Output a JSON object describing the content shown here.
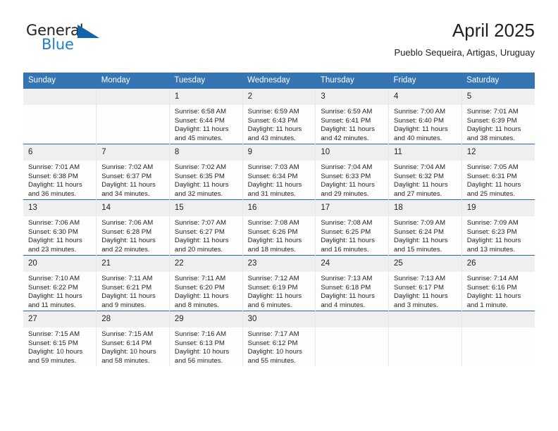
{
  "brand": {
    "word_top": "General",
    "word_bottom": "Blue",
    "triangle_icon": "triangle-logo-icon",
    "accent_dark": "#1464aa",
    "accent_light": "#1f7ec4"
  },
  "header": {
    "month_title": "April 2025",
    "location": "Pueblo Sequeira, Artigas, Uruguay",
    "header_bg": "#3575b4",
    "row_divider": "#1f6cb0",
    "daynum_bg": "#efefef"
  },
  "weekday_headers": [
    "Sunday",
    "Monday",
    "Tuesday",
    "Wednesday",
    "Thursday",
    "Friday",
    "Saturday"
  ],
  "labels": {
    "sunrise_prefix": "Sunrise:",
    "sunset_prefix": "Sunset:",
    "daylight_prefix": "Daylight:"
  },
  "weeks": [
    [
      {
        "date": "",
        "sunrise": "",
        "sunset": "",
        "daylight_line1": "",
        "daylight_line2": ""
      },
      {
        "date": "",
        "sunrise": "",
        "sunset": "",
        "daylight_line1": "",
        "daylight_line2": ""
      },
      {
        "date": "1",
        "sunrise": "Sunrise: 6:58 AM",
        "sunset": "Sunset: 6:44 PM",
        "daylight_line1": "Daylight: 11 hours",
        "daylight_line2": "and 45 minutes."
      },
      {
        "date": "2",
        "sunrise": "Sunrise: 6:59 AM",
        "sunset": "Sunset: 6:43 PM",
        "daylight_line1": "Daylight: 11 hours",
        "daylight_line2": "and 43 minutes."
      },
      {
        "date": "3",
        "sunrise": "Sunrise: 6:59 AM",
        "sunset": "Sunset: 6:41 PM",
        "daylight_line1": "Daylight: 11 hours",
        "daylight_line2": "and 42 minutes."
      },
      {
        "date": "4",
        "sunrise": "Sunrise: 7:00 AM",
        "sunset": "Sunset: 6:40 PM",
        "daylight_line1": "Daylight: 11 hours",
        "daylight_line2": "and 40 minutes."
      },
      {
        "date": "5",
        "sunrise": "Sunrise: 7:01 AM",
        "sunset": "Sunset: 6:39 PM",
        "daylight_line1": "Daylight: 11 hours",
        "daylight_line2": "and 38 minutes."
      }
    ],
    [
      {
        "date": "6",
        "sunrise": "Sunrise: 7:01 AM",
        "sunset": "Sunset: 6:38 PM",
        "daylight_line1": "Daylight: 11 hours",
        "daylight_line2": "and 36 minutes."
      },
      {
        "date": "7",
        "sunrise": "Sunrise: 7:02 AM",
        "sunset": "Sunset: 6:37 PM",
        "daylight_line1": "Daylight: 11 hours",
        "daylight_line2": "and 34 minutes."
      },
      {
        "date": "8",
        "sunrise": "Sunrise: 7:02 AM",
        "sunset": "Sunset: 6:35 PM",
        "daylight_line1": "Daylight: 11 hours",
        "daylight_line2": "and 32 minutes."
      },
      {
        "date": "9",
        "sunrise": "Sunrise: 7:03 AM",
        "sunset": "Sunset: 6:34 PM",
        "daylight_line1": "Daylight: 11 hours",
        "daylight_line2": "and 31 minutes."
      },
      {
        "date": "10",
        "sunrise": "Sunrise: 7:04 AM",
        "sunset": "Sunset: 6:33 PM",
        "daylight_line1": "Daylight: 11 hours",
        "daylight_line2": "and 29 minutes."
      },
      {
        "date": "11",
        "sunrise": "Sunrise: 7:04 AM",
        "sunset": "Sunset: 6:32 PM",
        "daylight_line1": "Daylight: 11 hours",
        "daylight_line2": "and 27 minutes."
      },
      {
        "date": "12",
        "sunrise": "Sunrise: 7:05 AM",
        "sunset": "Sunset: 6:31 PM",
        "daylight_line1": "Daylight: 11 hours",
        "daylight_line2": "and 25 minutes."
      }
    ],
    [
      {
        "date": "13",
        "sunrise": "Sunrise: 7:06 AM",
        "sunset": "Sunset: 6:30 PM",
        "daylight_line1": "Daylight: 11 hours",
        "daylight_line2": "and 23 minutes."
      },
      {
        "date": "14",
        "sunrise": "Sunrise: 7:06 AM",
        "sunset": "Sunset: 6:28 PM",
        "daylight_line1": "Daylight: 11 hours",
        "daylight_line2": "and 22 minutes."
      },
      {
        "date": "15",
        "sunrise": "Sunrise: 7:07 AM",
        "sunset": "Sunset: 6:27 PM",
        "daylight_line1": "Daylight: 11 hours",
        "daylight_line2": "and 20 minutes."
      },
      {
        "date": "16",
        "sunrise": "Sunrise: 7:08 AM",
        "sunset": "Sunset: 6:26 PM",
        "daylight_line1": "Daylight: 11 hours",
        "daylight_line2": "and 18 minutes."
      },
      {
        "date": "17",
        "sunrise": "Sunrise: 7:08 AM",
        "sunset": "Sunset: 6:25 PM",
        "daylight_line1": "Daylight: 11 hours",
        "daylight_line2": "and 16 minutes."
      },
      {
        "date": "18",
        "sunrise": "Sunrise: 7:09 AM",
        "sunset": "Sunset: 6:24 PM",
        "daylight_line1": "Daylight: 11 hours",
        "daylight_line2": "and 15 minutes."
      },
      {
        "date": "19",
        "sunrise": "Sunrise: 7:09 AM",
        "sunset": "Sunset: 6:23 PM",
        "daylight_line1": "Daylight: 11 hours",
        "daylight_line2": "and 13 minutes."
      }
    ],
    [
      {
        "date": "20",
        "sunrise": "Sunrise: 7:10 AM",
        "sunset": "Sunset: 6:22 PM",
        "daylight_line1": "Daylight: 11 hours",
        "daylight_line2": "and 11 minutes."
      },
      {
        "date": "21",
        "sunrise": "Sunrise: 7:11 AM",
        "sunset": "Sunset: 6:21 PM",
        "daylight_line1": "Daylight: 11 hours",
        "daylight_line2": "and 9 minutes."
      },
      {
        "date": "22",
        "sunrise": "Sunrise: 7:11 AM",
        "sunset": "Sunset: 6:20 PM",
        "daylight_line1": "Daylight: 11 hours",
        "daylight_line2": "and 8 minutes."
      },
      {
        "date": "23",
        "sunrise": "Sunrise: 7:12 AM",
        "sunset": "Sunset: 6:19 PM",
        "daylight_line1": "Daylight: 11 hours",
        "daylight_line2": "and 6 minutes."
      },
      {
        "date": "24",
        "sunrise": "Sunrise: 7:13 AM",
        "sunset": "Sunset: 6:18 PM",
        "daylight_line1": "Daylight: 11 hours",
        "daylight_line2": "and 4 minutes."
      },
      {
        "date": "25",
        "sunrise": "Sunrise: 7:13 AM",
        "sunset": "Sunset: 6:17 PM",
        "daylight_line1": "Daylight: 11 hours",
        "daylight_line2": "and 3 minutes."
      },
      {
        "date": "26",
        "sunrise": "Sunrise: 7:14 AM",
        "sunset": "Sunset: 6:16 PM",
        "daylight_line1": "Daylight: 11 hours",
        "daylight_line2": "and 1 minute."
      }
    ],
    [
      {
        "date": "27",
        "sunrise": "Sunrise: 7:15 AM",
        "sunset": "Sunset: 6:15 PM",
        "daylight_line1": "Daylight: 10 hours",
        "daylight_line2": "and 59 minutes."
      },
      {
        "date": "28",
        "sunrise": "Sunrise: 7:15 AM",
        "sunset": "Sunset: 6:14 PM",
        "daylight_line1": "Daylight: 10 hours",
        "daylight_line2": "and 58 minutes."
      },
      {
        "date": "29",
        "sunrise": "Sunrise: 7:16 AM",
        "sunset": "Sunset: 6:13 PM",
        "daylight_line1": "Daylight: 10 hours",
        "daylight_line2": "and 56 minutes."
      },
      {
        "date": "30",
        "sunrise": "Sunrise: 7:17 AM",
        "sunset": "Sunset: 6:12 PM",
        "daylight_line1": "Daylight: 10 hours",
        "daylight_line2": "and 55 minutes."
      },
      {
        "date": "",
        "sunrise": "",
        "sunset": "",
        "daylight_line1": "",
        "daylight_line2": ""
      },
      {
        "date": "",
        "sunrise": "",
        "sunset": "",
        "daylight_line1": "",
        "daylight_line2": ""
      },
      {
        "date": "",
        "sunrise": "",
        "sunset": "",
        "daylight_line1": "",
        "daylight_line2": ""
      }
    ]
  ]
}
